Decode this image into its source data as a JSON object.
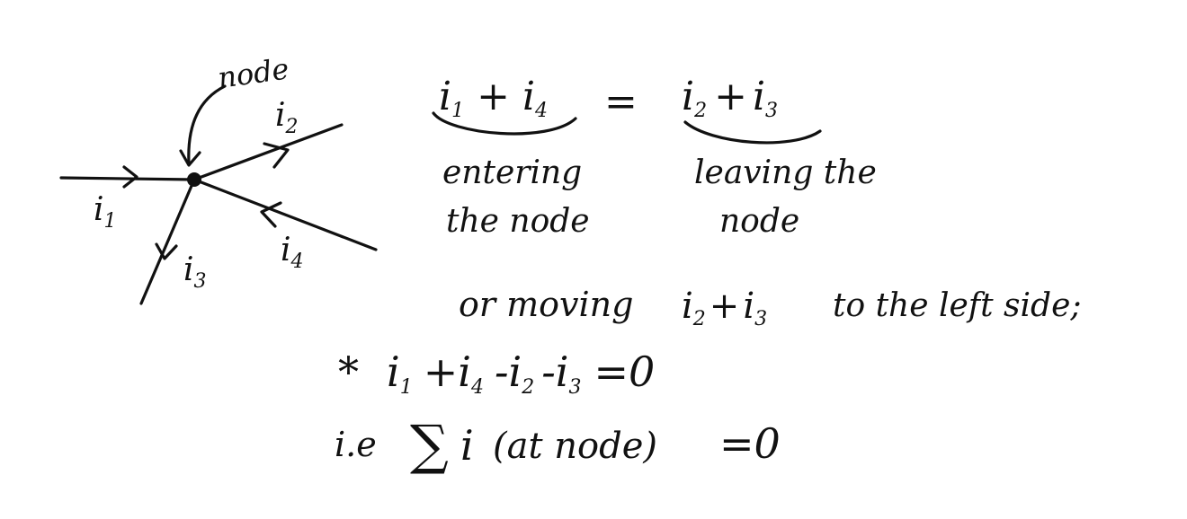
{
  "diagram": {
    "node_label": "node",
    "currents": {
      "i1": {
        "base": "i",
        "sub": "1"
      },
      "i2": {
        "base": "i",
        "sub": "2"
      },
      "i3": {
        "base": "i",
        "sub": "3"
      },
      "i4": {
        "base": "i",
        "sub": "4"
      }
    }
  },
  "notes": {
    "eq1_lhs": {
      "a": "i",
      "a_sub": "1",
      "op": "+",
      "b": "i",
      "b_sub": "4"
    },
    "eq1_equals": "=",
    "eq1_rhs": {
      "a": "i",
      "a_sub": "2",
      "op": "+",
      "b": "i",
      "b_sub": "3"
    },
    "entering_line1": "entering",
    "entering_line2": "the node",
    "leaving_line1": "leaving the",
    "leaving_line2": "node",
    "move_text_a": "or moving",
    "move_text_b": "to the left side;",
    "move_terms": {
      "a": "i",
      "a_sub": "2",
      "op": "+",
      "b": "i",
      "b_sub": "3"
    },
    "star": "*",
    "eq2": {
      "t1": "i",
      "t1_sub": "1",
      "t2": "+i",
      "t2_sub": "4",
      "t3": "-i",
      "t3_sub": "2",
      "t4": "-i",
      "t4_sub": "3",
      "rest": "=0"
    },
    "eq3": {
      "prefix": "i.e",
      "sigma": "∑",
      "i": "i",
      "paren": "(at node)",
      "rest": "=0"
    }
  }
}
